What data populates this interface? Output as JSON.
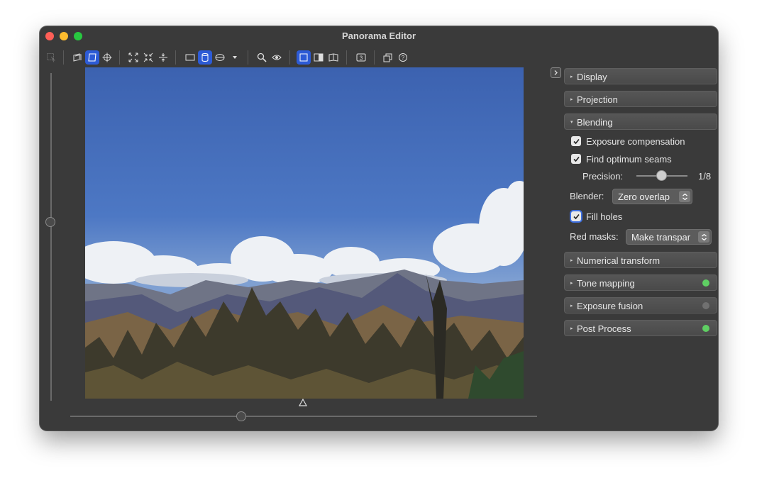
{
  "window": {
    "title": "Panorama Editor"
  },
  "toolbar": {
    "icons": [
      "select-icon",
      "preview-mode-icon",
      "drag-mode-icon",
      "crosshair-icon",
      "fit-icon",
      "center-icon",
      "straighten-icon",
      "rectilinear-icon",
      "cylindrical-icon",
      "equirectangular-icon",
      "projection-dropdown-icon",
      "zoom-icon",
      "preview-eye-icon",
      "single-view-icon",
      "split-view-icon",
      "book-view-icon",
      "badge-icon",
      "overview-icon",
      "help-icon"
    ],
    "badge_text": "3"
  },
  "sections": {
    "display": "Display",
    "projection": "Projection",
    "blending": "Blending",
    "numerical_transform": "Numerical transform",
    "tone_mapping": "Tone mapping",
    "exposure_fusion": "Exposure fusion",
    "post_process": "Post Process"
  },
  "blending": {
    "exposure_compensation": {
      "label": "Exposure compensation",
      "checked": true
    },
    "find_optimum_seams": {
      "label": "Find optimum seams",
      "checked": true
    },
    "precision": {
      "label": "Precision:",
      "value": "1/8"
    },
    "blender": {
      "label": "Blender:",
      "value": "Zero overlap"
    },
    "fill_holes": {
      "label": "Fill holes",
      "checked": true
    },
    "red_masks": {
      "label": "Red masks:",
      "value": "Make transpar"
    }
  },
  "status_colors": {
    "tone_mapping": "#5fcf63",
    "exposure_fusion": "#707070",
    "post_process": "#5fcf63"
  },
  "colors": {
    "accent": "#2d5bd6",
    "window_bg": "#3a3a3a",
    "sky": "#4a74c0"
  }
}
